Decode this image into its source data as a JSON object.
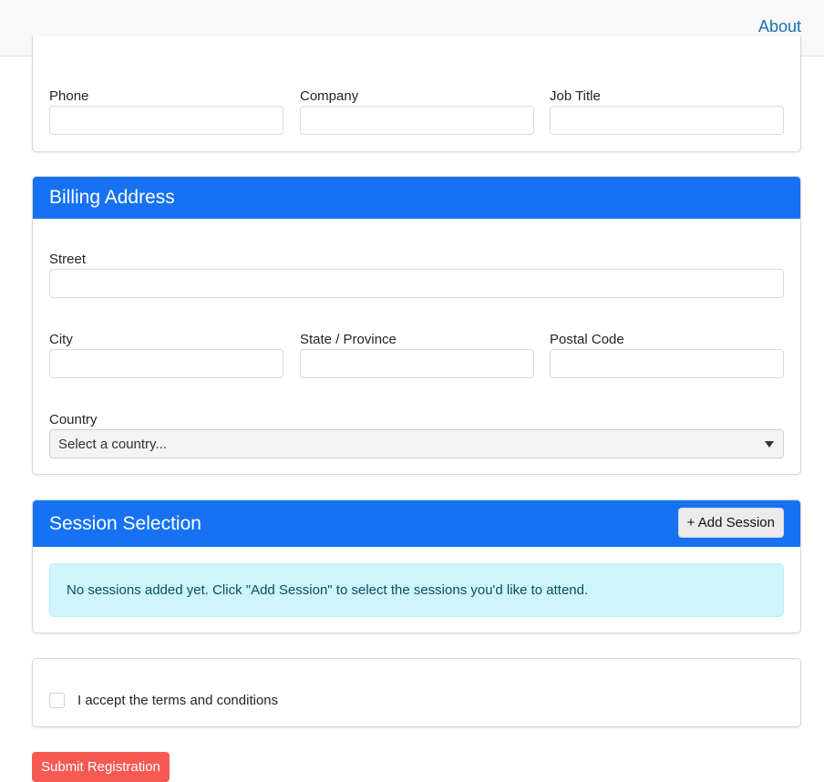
{
  "nav": {
    "about_label": "About"
  },
  "contact": {
    "phone_label": "Phone",
    "company_label": "Company",
    "job_title_label": "Job Title"
  },
  "billing": {
    "title": "Billing Address",
    "street_label": "Street",
    "city_label": "City",
    "state_label": "State / Province",
    "postal_label": "Postal Code",
    "country_label": "Country",
    "country_selected": "Select a country..."
  },
  "sessions": {
    "title": "Session Selection",
    "add_button": "+ Add Session",
    "empty_message": "No sessions added yet. Click \"Add Session\" to select the sessions you'd like to attend."
  },
  "terms": {
    "label": "I accept the terms and conditions"
  },
  "submit": {
    "label": "Submit Registration"
  },
  "colors": {
    "header_blue": "#1672f3",
    "alert_bg": "#cff4fc",
    "submit_red": "#f65a52",
    "link_blue": "#1a6fb3"
  }
}
